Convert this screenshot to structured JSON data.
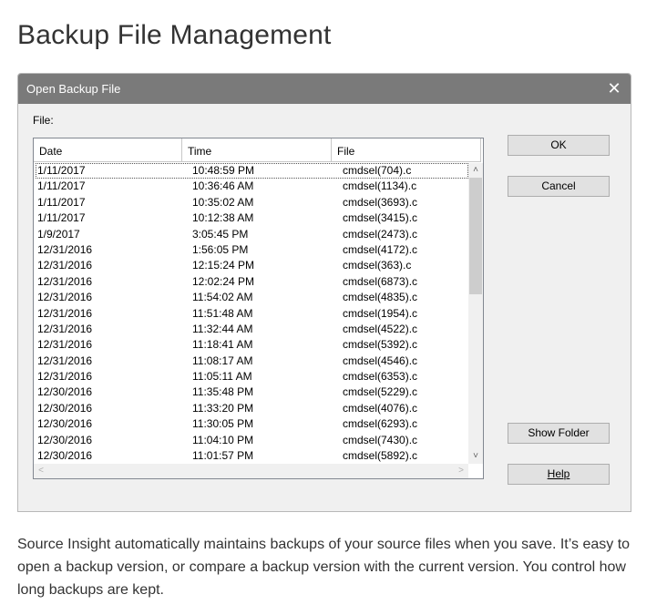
{
  "page": {
    "title": "Backup File Management",
    "description": "Source Insight automatically maintains backups of your source files when you save. It’s easy to open a backup version, or compare a backup version with the current version. You control how long backups are kept."
  },
  "dialog": {
    "title": "Open Backup File",
    "close_icon": "close-icon",
    "close_glyph": "✕",
    "file_label": "File:",
    "columns": [
      "Date",
      "Time",
      "File"
    ],
    "rows": [
      {
        "date": "1/11/2017",
        "time": "10:48:59 PM",
        "file": "cmdsel(704).c"
      },
      {
        "date": "1/11/2017",
        "time": "10:36:46 AM",
        "file": "cmdsel(1134).c"
      },
      {
        "date": "1/11/2017",
        "time": "10:35:02 AM",
        "file": "cmdsel(3693).c"
      },
      {
        "date": "1/11/2017",
        "time": "10:12:38 AM",
        "file": "cmdsel(3415).c"
      },
      {
        "date": "1/9/2017",
        "time": "3:05:45 PM",
        "file": "cmdsel(2473).c"
      },
      {
        "date": "12/31/2016",
        "time": "1:56:05 PM",
        "file": "cmdsel(4172).c"
      },
      {
        "date": "12/31/2016",
        "time": "12:15:24 PM",
        "file": "cmdsel(363).c"
      },
      {
        "date": "12/31/2016",
        "time": "12:02:24 PM",
        "file": "cmdsel(6873).c"
      },
      {
        "date": "12/31/2016",
        "time": "11:54:02 AM",
        "file": "cmdsel(4835).c"
      },
      {
        "date": "12/31/2016",
        "time": "11:51:48 AM",
        "file": "cmdsel(1954).c"
      },
      {
        "date": "12/31/2016",
        "time": "11:32:44 AM",
        "file": "cmdsel(4522).c"
      },
      {
        "date": "12/31/2016",
        "time": "11:18:41 AM",
        "file": "cmdsel(5392).c"
      },
      {
        "date": "12/31/2016",
        "time": "11:08:17 AM",
        "file": "cmdsel(4546).c"
      },
      {
        "date": "12/31/2016",
        "time": "11:05:11 AM",
        "file": "cmdsel(6353).c"
      },
      {
        "date": "12/30/2016",
        "time": "11:35:48 PM",
        "file": "cmdsel(5229).c"
      },
      {
        "date": "12/30/2016",
        "time": "11:33:20 PM",
        "file": "cmdsel(4076).c"
      },
      {
        "date": "12/30/2016",
        "time": "11:30:05 PM",
        "file": "cmdsel(6293).c"
      },
      {
        "date": "12/30/2016",
        "time": "11:04:10 PM",
        "file": "cmdsel(7430).c"
      },
      {
        "date": "12/30/2016",
        "time": "11:01:57 PM",
        "file": "cmdsel(5892).c"
      }
    ],
    "scroll_glyphs": {
      "up": "˄",
      "down": "˅",
      "left": "˂",
      "right": "˃"
    },
    "buttons": {
      "ok": "OK",
      "cancel": "Cancel",
      "show_folder": "Show Folder",
      "help": "Help"
    }
  },
  "colors": {
    "titlebar": "#7a7a7a",
    "dialog_bg": "#f0f0f0",
    "button_bg": "#e1e1e1",
    "text": "#333333"
  }
}
